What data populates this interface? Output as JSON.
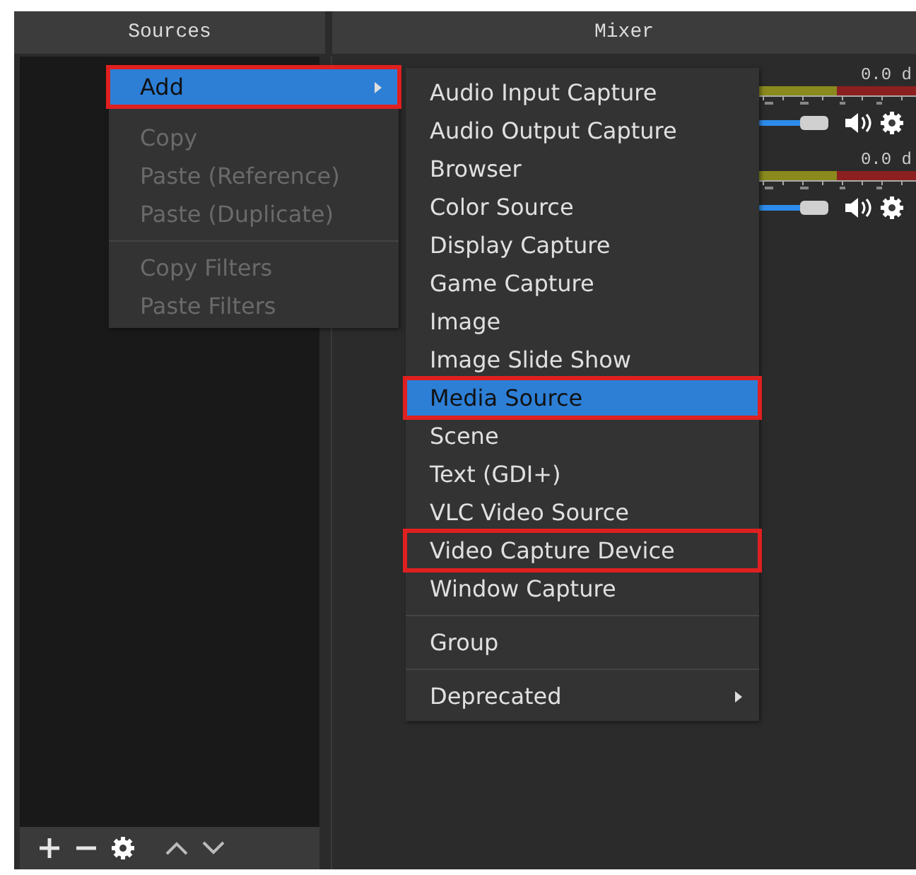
{
  "docks": [
    {
      "title": "Sources"
    },
    {
      "title": "Mixer"
    }
  ],
  "context_menu": [
    {
      "label": "Add",
      "kind": "submenu",
      "selected": true,
      "annotated": true,
      "disabled": false
    },
    {
      "label": "Copy",
      "kind": "item",
      "selected": false,
      "annotated": false,
      "disabled": true
    },
    {
      "label": "Paste (Reference)",
      "kind": "item",
      "selected": false,
      "annotated": false,
      "disabled": true
    },
    {
      "label": "Paste (Duplicate)",
      "kind": "item",
      "selected": false,
      "annotated": false,
      "disabled": true
    },
    {
      "kind": "separator"
    },
    {
      "label": "Copy Filters",
      "kind": "item",
      "selected": false,
      "annotated": false,
      "disabled": true
    },
    {
      "label": "Paste Filters",
      "kind": "item",
      "selected": false,
      "annotated": false,
      "disabled": true
    }
  ],
  "add_submenu": [
    {
      "label": "Audio Input Capture",
      "kind": "item",
      "selected": false,
      "annotated": false
    },
    {
      "label": "Audio Output Capture",
      "kind": "item",
      "selected": false,
      "annotated": false
    },
    {
      "label": "Browser",
      "kind": "item",
      "selected": false,
      "annotated": false
    },
    {
      "label": "Color Source",
      "kind": "item",
      "selected": false,
      "annotated": false
    },
    {
      "label": "Display Capture",
      "kind": "item",
      "selected": false,
      "annotated": false
    },
    {
      "label": "Game Capture",
      "kind": "item",
      "selected": false,
      "annotated": false
    },
    {
      "label": "Image",
      "kind": "item",
      "selected": false,
      "annotated": false
    },
    {
      "label": "Image Slide Show",
      "kind": "item",
      "selected": false,
      "annotated": false
    },
    {
      "label": "Media Source",
      "kind": "item",
      "selected": true,
      "annotated": true
    },
    {
      "label": "Scene",
      "kind": "item",
      "selected": false,
      "annotated": false
    },
    {
      "label": "Text (GDI+)",
      "kind": "item",
      "selected": false,
      "annotated": false
    },
    {
      "label": "VLC Video Source",
      "kind": "item",
      "selected": false,
      "annotated": false
    },
    {
      "label": "Video Capture Device",
      "kind": "item",
      "selected": false,
      "annotated": true
    },
    {
      "label": "Window Capture",
      "kind": "item",
      "selected": false,
      "annotated": false
    },
    {
      "kind": "separator"
    },
    {
      "label": "Group",
      "kind": "item",
      "selected": false,
      "annotated": false
    },
    {
      "kind": "separator"
    },
    {
      "label": "Deprecated",
      "kind": "submenu",
      "selected": false,
      "annotated": false
    }
  ],
  "mixer_channels": [
    {
      "reading": "0.0 d",
      "level": 0.72
    },
    {
      "reading": "0.0 d",
      "level": 0.72
    }
  ]
}
